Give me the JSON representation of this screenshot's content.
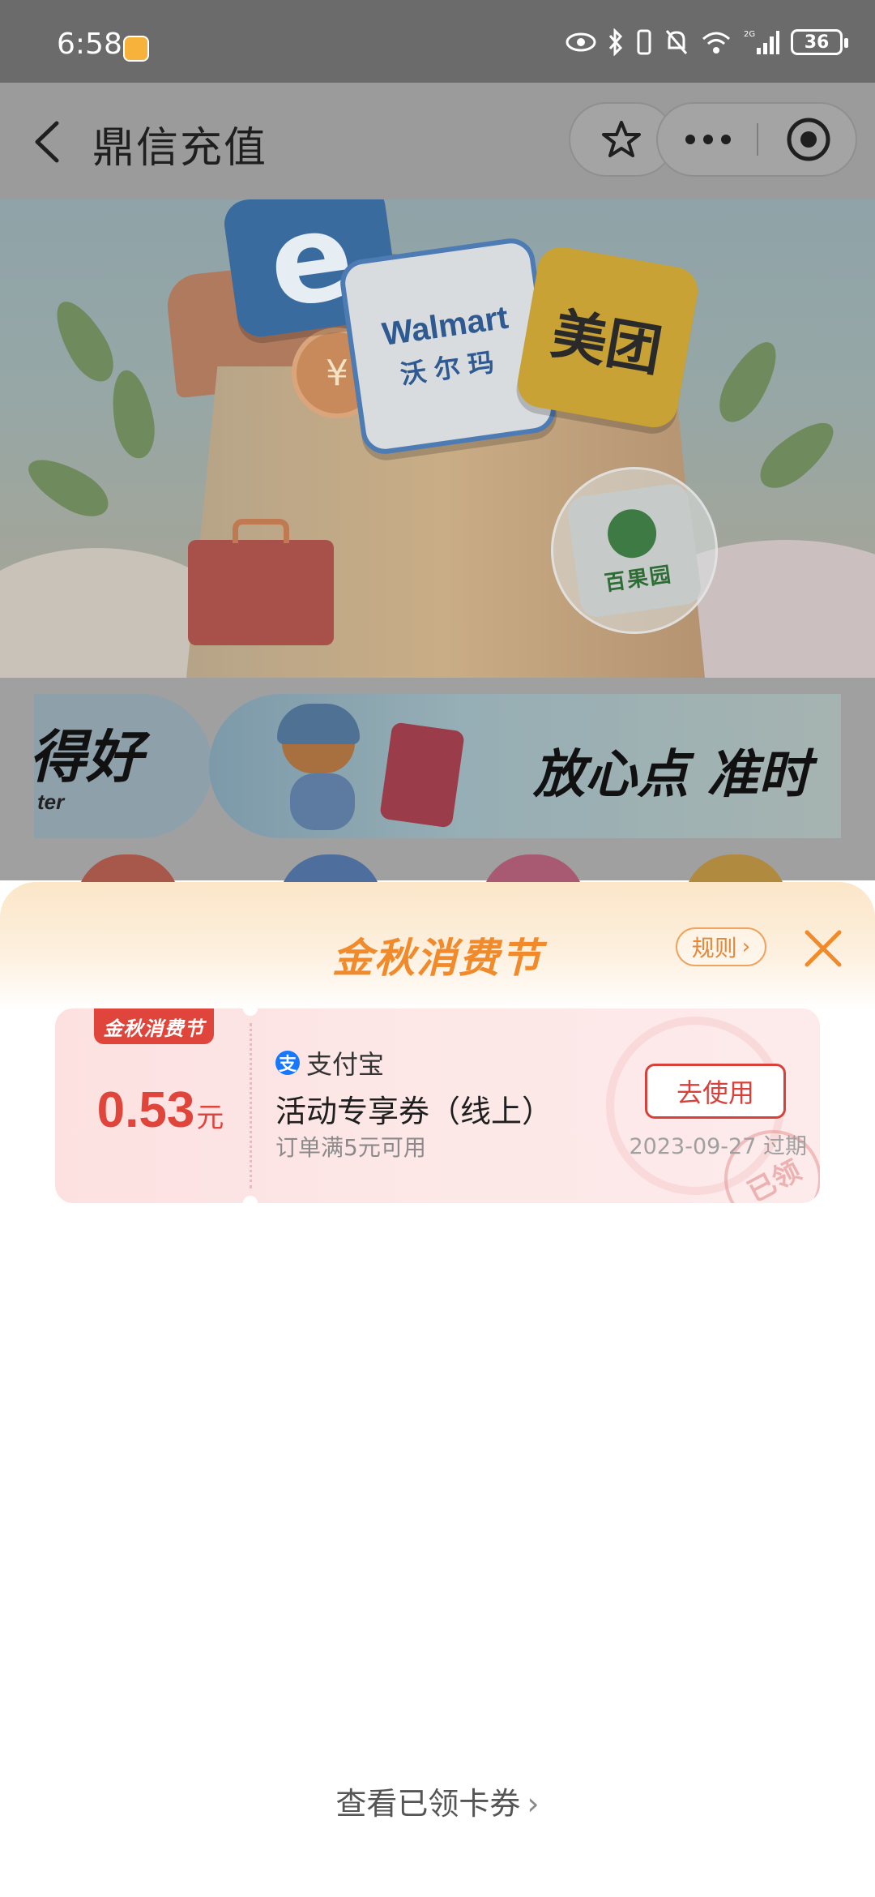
{
  "status_bar": {
    "time": "6:58",
    "battery": "36",
    "icons": [
      "app-notification-icon",
      "eye-icon",
      "bluetooth-icon",
      "vibrate-icon",
      "mute-icon",
      "wifi-icon",
      "signal-2g-icon",
      "battery-icon"
    ]
  },
  "header": {
    "title": "鼎信充值",
    "icons": [
      "back-arrow-icon",
      "star-icon",
      "more-dots-icon",
      "close-miniprogram-icon"
    ]
  },
  "banner": {
    "tiles": {
      "walmart_en": "Walmart",
      "walmart_cn": "沃尔玛",
      "meituan": "美团",
      "baiguoyuan": "百果园",
      "coin_symbol": "¥",
      "e_letter": "e"
    }
  },
  "promo": {
    "left_text": "得好",
    "left_sub": "ter",
    "right_text": "放心点 准时"
  },
  "sheet": {
    "title": "金秋消费节",
    "rules_label": "规则",
    "coupon": {
      "ribbon": "金秋消费节",
      "amount": "0.53",
      "unit": "元",
      "source": "支付宝",
      "alipay_glyph": "支",
      "name": "活动专享券（线上）",
      "condition": "订单满5元可用",
      "use_button": "去使用",
      "expiry": "2023-09-27 过期",
      "stamp": "已领"
    },
    "view_claimed": "查看已领卡券"
  },
  "colors": {
    "accent_orange": "#f08a2a",
    "coupon_red": "#e0453c",
    "overlay_gray": "#9b9b9b"
  }
}
